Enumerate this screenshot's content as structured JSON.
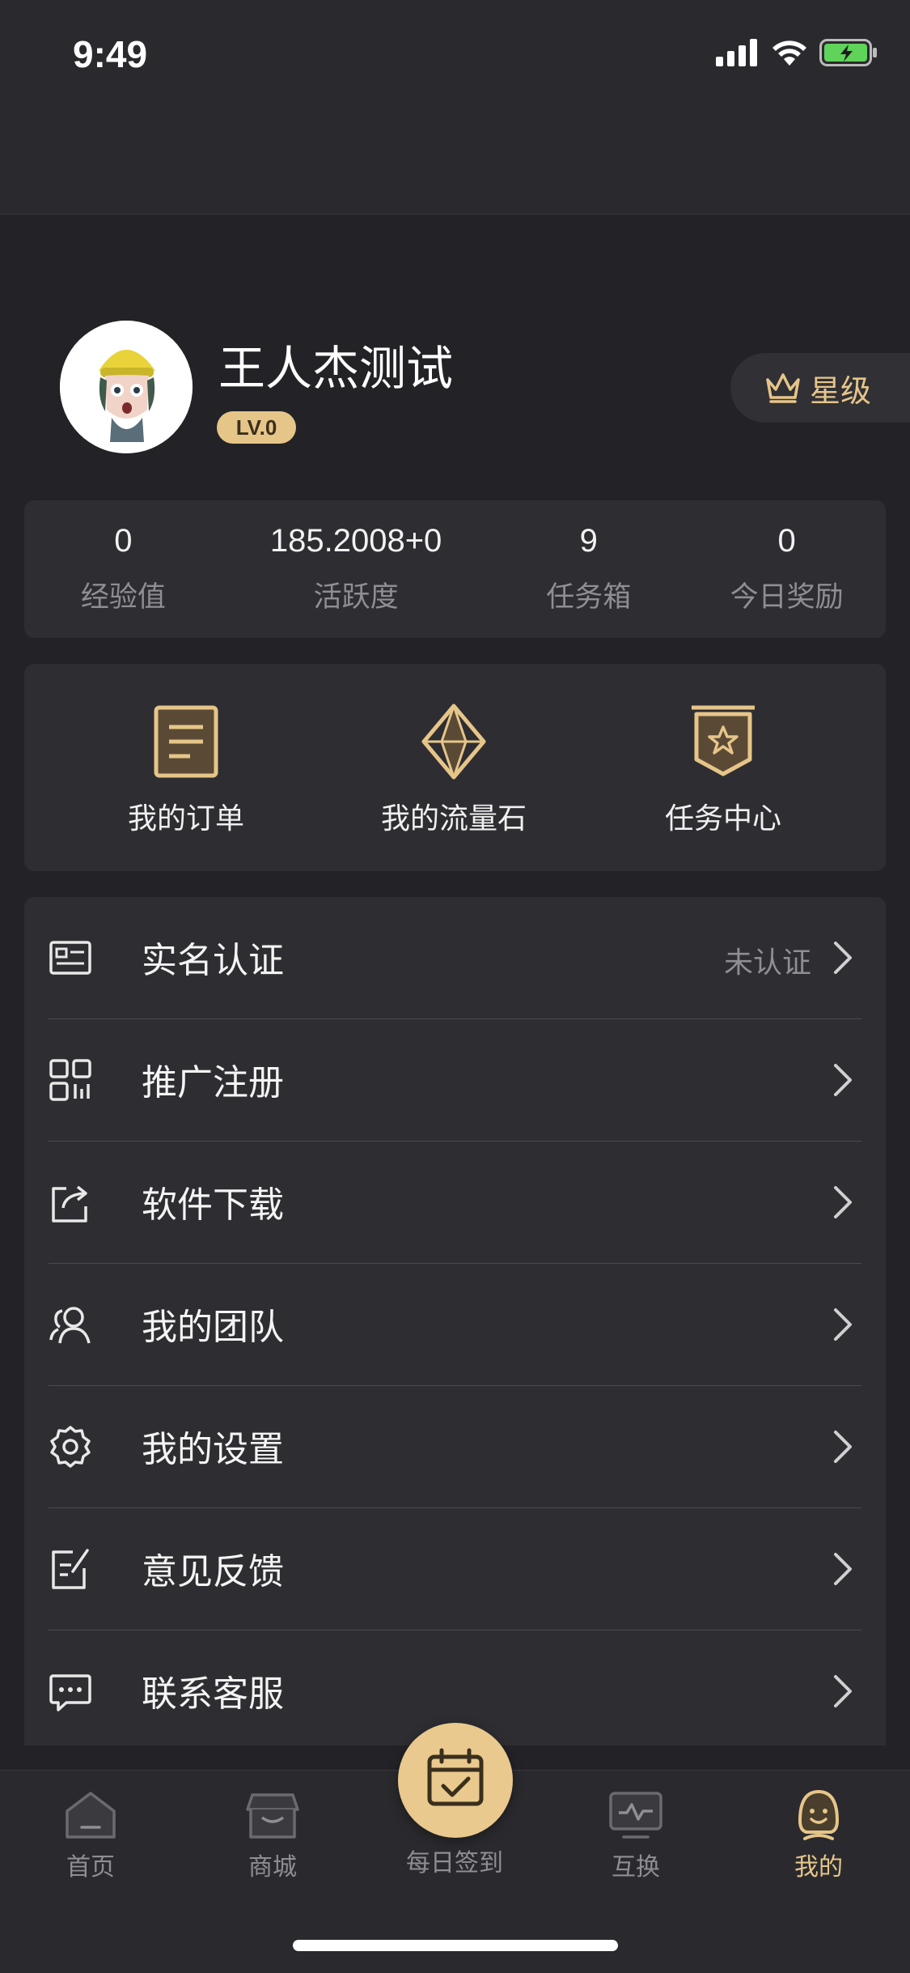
{
  "status_bar": {
    "time": "9:49"
  },
  "profile": {
    "username": "王人杰测试",
    "level": "LV.0",
    "star_button": "星级"
  },
  "stats": [
    {
      "value": "0",
      "label": "经验值"
    },
    {
      "value": "185.2008+0",
      "label": "活跃度"
    },
    {
      "value": "9",
      "label": "任务箱"
    },
    {
      "value": "0",
      "label": "今日奖励"
    }
  ],
  "quick_actions": [
    {
      "label": "我的订单",
      "icon": "order-icon"
    },
    {
      "label": "我的流量石",
      "icon": "diamond-icon"
    },
    {
      "label": "任务中心",
      "icon": "task-badge-icon"
    }
  ],
  "menu": [
    {
      "label": "实名认证",
      "status": "未认证",
      "icon": "id-card-icon"
    },
    {
      "label": "推广注册",
      "status": "",
      "icon": "qr-code-icon"
    },
    {
      "label": "软件下载",
      "status": "",
      "icon": "share-export-icon"
    },
    {
      "label": "我的团队",
      "status": "",
      "icon": "team-icon"
    },
    {
      "label": "我的设置",
      "status": "",
      "icon": "gear-icon"
    },
    {
      "label": "意见反馈",
      "status": "",
      "icon": "feedback-icon"
    },
    {
      "label": "联系客服",
      "status": "",
      "icon": "chat-icon"
    }
  ],
  "tabbar": {
    "home": "首页",
    "mall": "商城",
    "checkin": "每日签到",
    "exchange": "互换",
    "mine": "我的"
  },
  "colors": {
    "background": "#232226",
    "card": "#2e2d32",
    "accent_gold": "#e6c589",
    "muted_text": "#8e8e93"
  }
}
